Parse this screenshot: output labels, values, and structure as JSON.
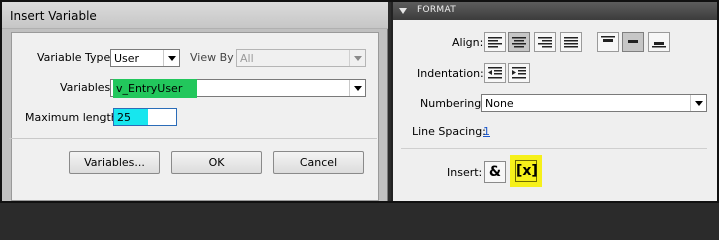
{
  "dialog": {
    "title": "Insert Variable",
    "variable_type_label": "Variable Type",
    "variable_type_value": "User",
    "view_by_label": "View By",
    "view_by_value": "All",
    "variables_label": "Variables",
    "variables_value": "v_EntryUser",
    "max_length_label": "Maximum length",
    "max_length_value": "25",
    "buttons": {
      "variables": "Variables...",
      "ok": "OK",
      "cancel": "Cancel"
    },
    "highlight_colors": {
      "variables": "#22c75c",
      "max_length": "#17e6ee"
    }
  },
  "format_panel": {
    "title": "FORMAT",
    "align_label": "Align:",
    "indentation_label": "Indentation:",
    "numbering_label": "Numbering:",
    "numbering_value": "None",
    "line_spacing_label": "Line Spacing:",
    "line_spacing_value": "1",
    "insert_label": "Insert:",
    "insert_ampersand": "&",
    "insert_variable": "[x]",
    "highlight_color": "#f6f01a",
    "icons": [
      "align-left-icon",
      "align-center-icon",
      "align-right-icon",
      "align-justify-icon",
      "valign-top-icon",
      "valign-middle-icon",
      "valign-bottom-icon",
      "indent-decrease-icon",
      "indent-increase-icon"
    ]
  }
}
